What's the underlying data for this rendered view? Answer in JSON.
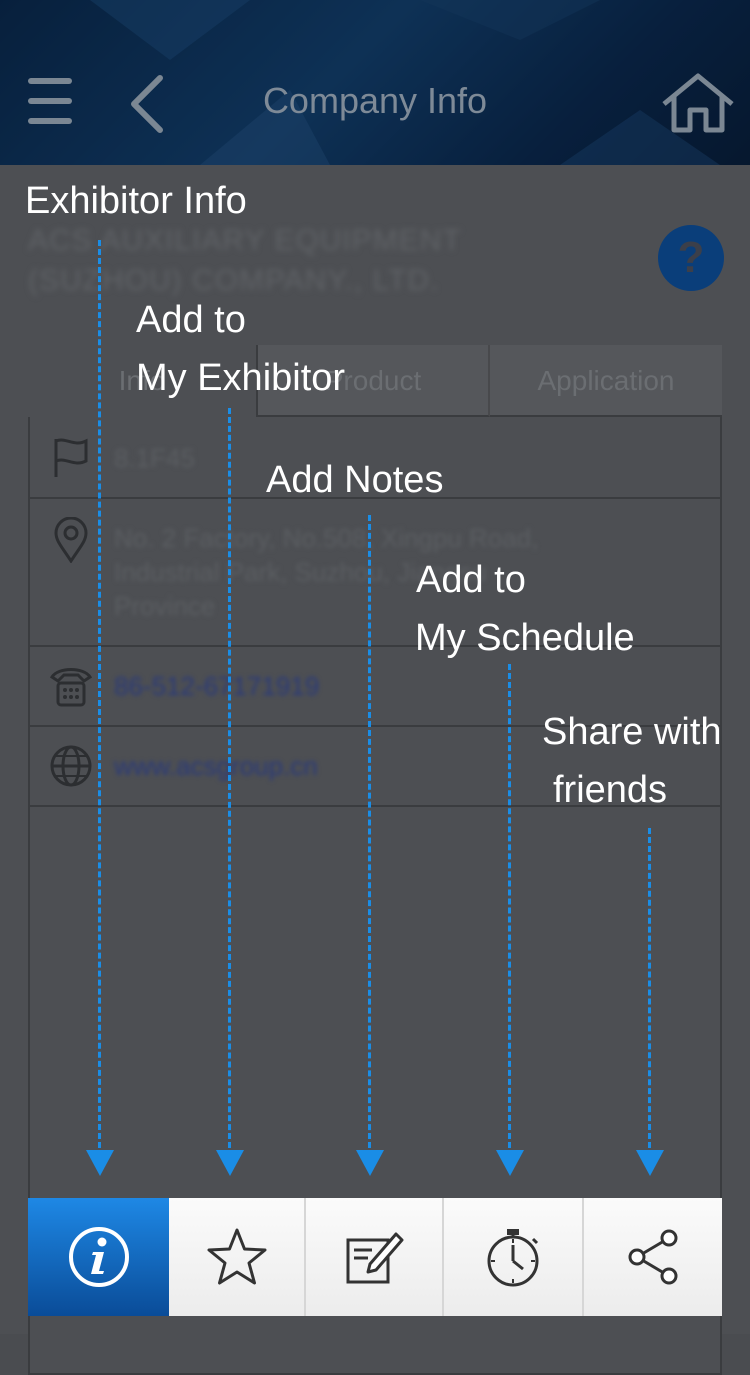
{
  "header": {
    "title": "Company Info",
    "menu_icon": "hamburger-icon",
    "back_icon": "chevron-left-icon",
    "home_icon": "home-icon"
  },
  "company": {
    "name_line1": "ACS AUXILIARY EQUIPMENT",
    "name_line2": "(SUZHOU) COMPANY., LTD.",
    "help_label": "?"
  },
  "tabs": [
    {
      "label": "Info"
    },
    {
      "label": "Product"
    },
    {
      "label": "Application"
    }
  ],
  "details": {
    "booth": "8.1F45",
    "address_line1": "No. 2 Factory, No.508, Xingpu Road,",
    "address_line2": "Industrial Park, Suzhou, Jiangsu",
    "address_line3": "Province",
    "phone": "86-512-67171919",
    "website": "www.acsgroup.cn"
  },
  "overlay": {
    "exhibitor_info": "Exhibitor Info",
    "add_to_1": "Add to",
    "my_exhibitor": "My Exhibitor",
    "add_notes": "Add Notes",
    "add_to_2": "Add to",
    "my_schedule": "My Schedule",
    "share_with": "Share with",
    "friends": "friends"
  },
  "toolbar": {
    "items": [
      {
        "icon": "info-icon",
        "active": true
      },
      {
        "icon": "star-icon",
        "active": false
      },
      {
        "icon": "notes-icon",
        "active": false
      },
      {
        "icon": "timer-icon",
        "active": false
      },
      {
        "icon": "share-icon",
        "active": false
      }
    ]
  },
  "colors": {
    "accent": "#1a8de6",
    "active_tab": "#0a4c98",
    "overlay_bg": "#4d4f53"
  }
}
